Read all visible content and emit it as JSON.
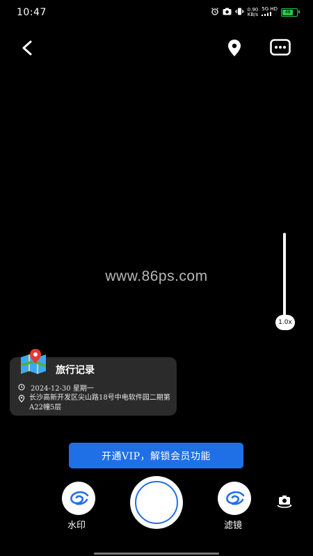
{
  "status_bar": {
    "time": "10:47",
    "netspeed_value": "0.90",
    "netspeed_unit": "KB/s",
    "network": "5G HD",
    "battery": "48"
  },
  "watermark_text": "www.86ps.com",
  "zoom": {
    "label": "1.0x"
  },
  "info_card": {
    "title": "旅行记录",
    "date": "2024-12-30  星期一",
    "address": "长沙高新开发区尖山路18号中电软件园二期第A22幢5层"
  },
  "vip_banner": "开通VIP，解锁会员功能",
  "bottom": {
    "watermark_label": "水印",
    "filter_label": "滤镜"
  },
  "icons": {
    "back": "back-arrow-icon",
    "location": "location-pin-icon",
    "more": "more-dots-icon",
    "switch": "camera-switch-icon"
  },
  "colors": {
    "accent": "#1f6fe6",
    "battery": "#29c94a"
  }
}
